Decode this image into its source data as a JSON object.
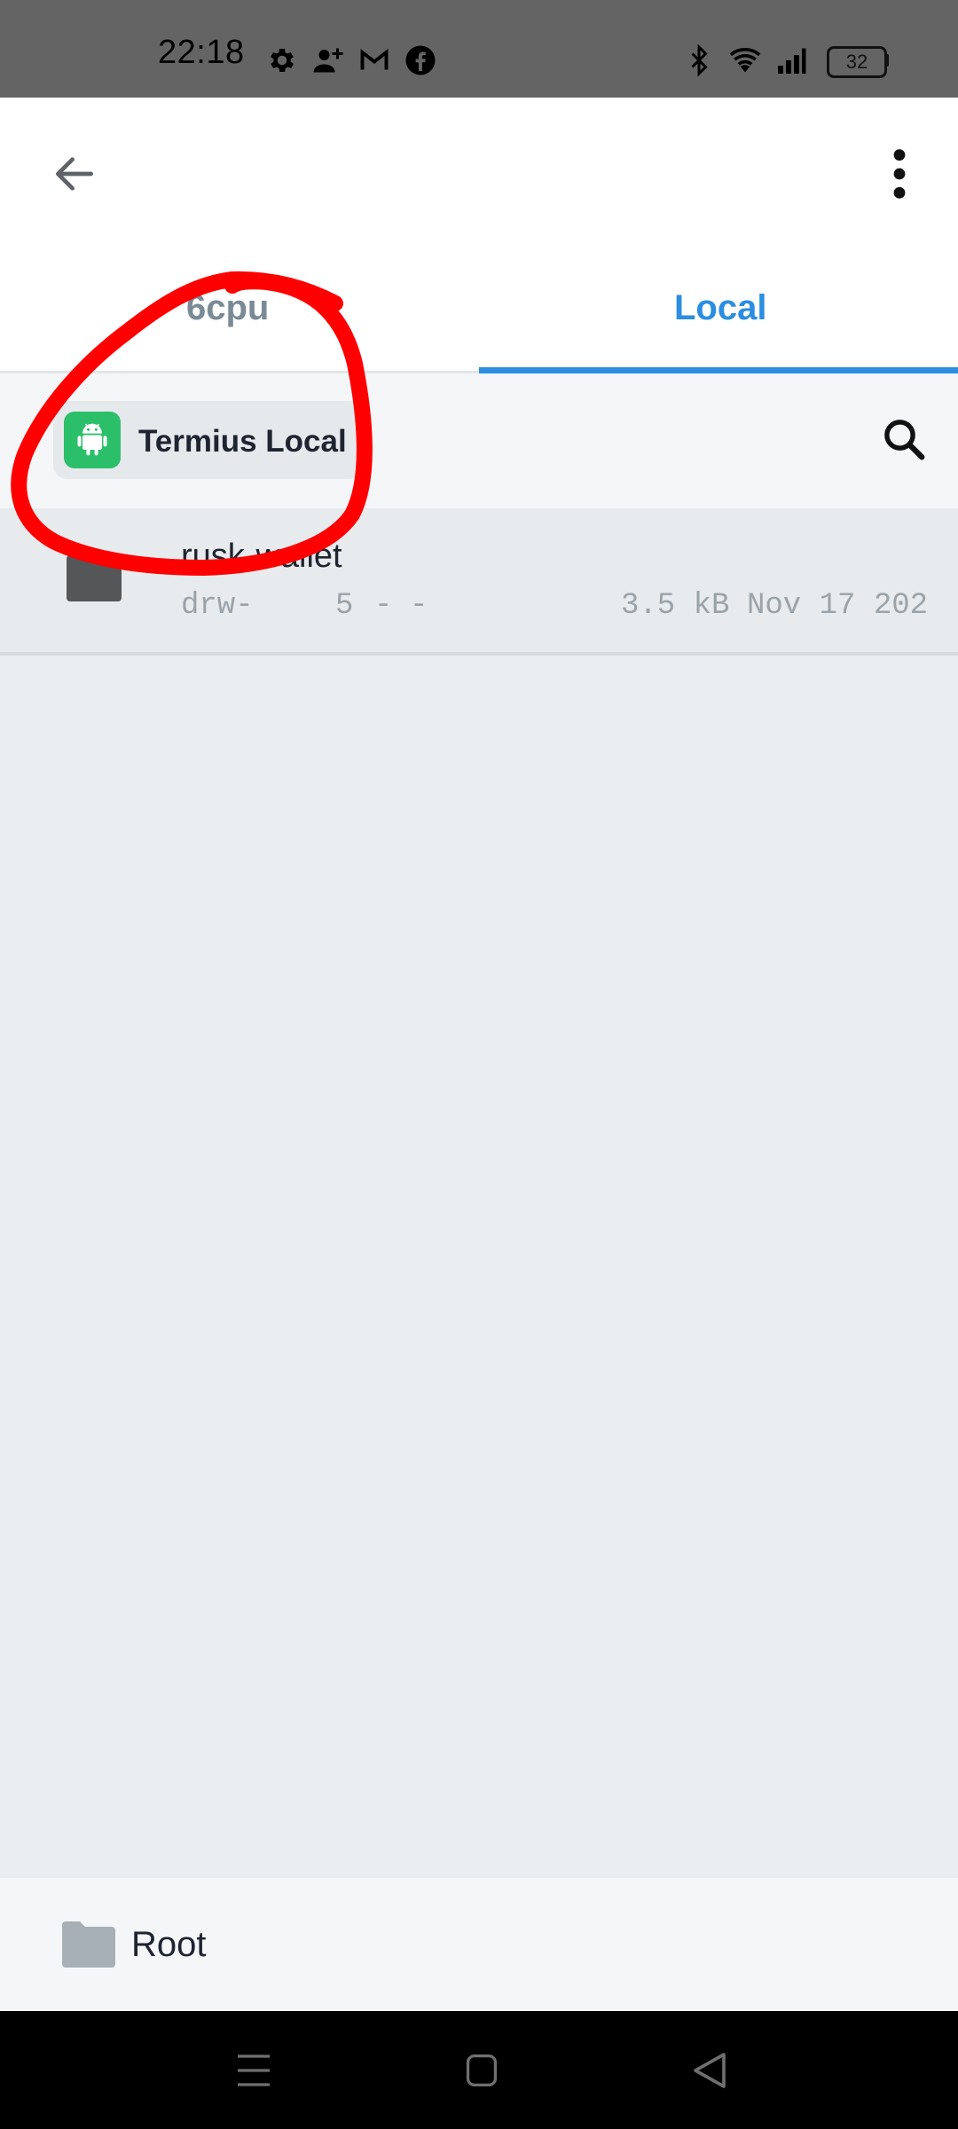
{
  "status_bar": {
    "time": "22:18",
    "icons": [
      "gear-icon",
      "person-add-icon",
      "gmail-icon",
      "facebook-icon",
      "bluetooth-icon",
      "wifi-icon",
      "signal-icon"
    ],
    "battery_level": "32"
  },
  "app_bar": {
    "back_icon": "arrow-left-icon",
    "menu_icon": "more-vert-icon"
  },
  "tabs": [
    {
      "label": "6cpu",
      "active": false
    },
    {
      "label": "Local",
      "active": true
    }
  ],
  "location": {
    "chip_label": "Termius Local",
    "chip_icon": "android-icon",
    "search_icon": "search-icon"
  },
  "files": [
    {
      "name": "rusk-wallet",
      "permissions": "drw-",
      "links": "5",
      "owner": "-",
      "group": "-",
      "size": "3.5 kB",
      "date": "Nov 17 202"
    }
  ],
  "bottom_bar": {
    "label": "Root",
    "icon": "folder-icon"
  },
  "nav_bar": {
    "icons": [
      "recents-icon",
      "home-icon",
      "back-triangle-icon"
    ]
  },
  "colors": {
    "accent": "#2b8ee0",
    "android_green": "#2bbf6a",
    "annotation_red": "#ff0000",
    "status_bar_bg": "#646464"
  }
}
